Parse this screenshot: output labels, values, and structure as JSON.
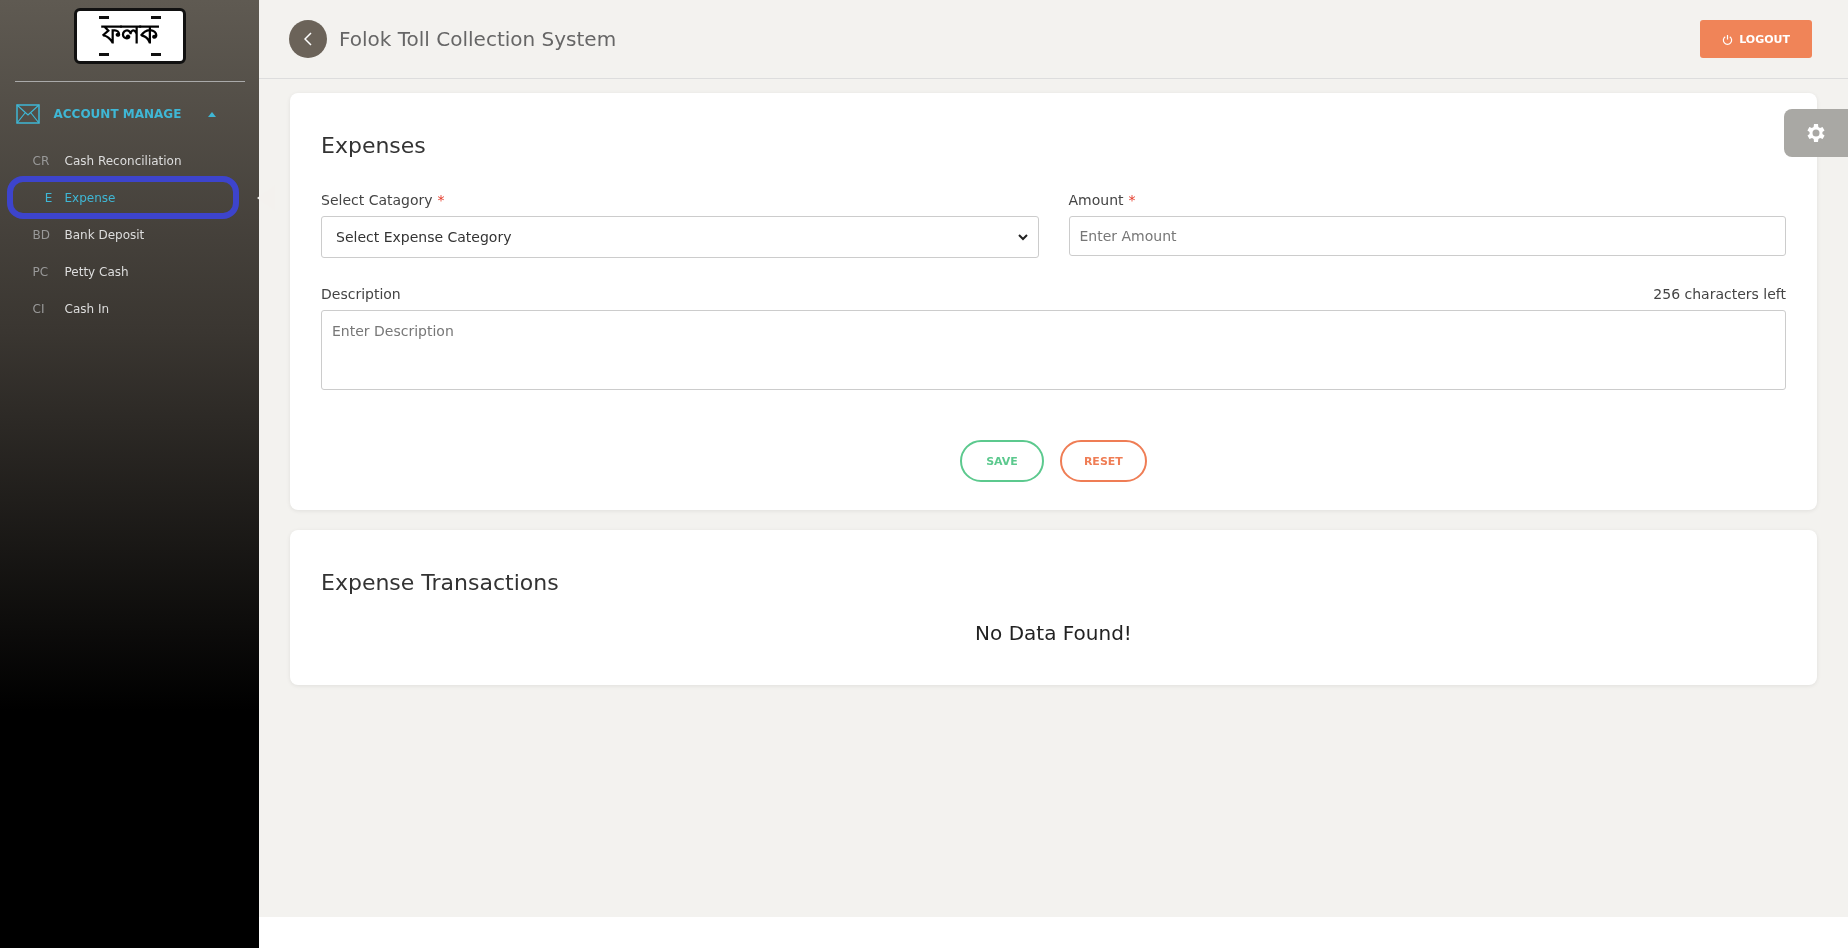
{
  "sidebar": {
    "logo_text": "ফলক",
    "section": {
      "label": "ACCOUNT MANAGE",
      "expanded": true
    },
    "items": [
      {
        "abbr": "CR",
        "label": "Cash Reconciliation",
        "selected": false,
        "circled": false
      },
      {
        "abbr": "E",
        "label": "Expense",
        "selected": true,
        "circled": true
      },
      {
        "abbr": "BD",
        "label": "Bank Deposit",
        "selected": false,
        "circled": false
      },
      {
        "abbr": "PC",
        "label": "Petty Cash",
        "selected": false,
        "circled": false
      },
      {
        "abbr": "CI",
        "label": "Cash In",
        "selected": false,
        "circled": false
      }
    ]
  },
  "header": {
    "title": "Folok Toll Collection System",
    "logout": "LOGOUT"
  },
  "form": {
    "title": "Expenses",
    "category": {
      "label": "Select Catagory",
      "required_mark": "*",
      "value": "Select Expense Category"
    },
    "amount": {
      "label": "Amount",
      "required_mark": "*",
      "placeholder": "Enter Amount"
    },
    "description": {
      "label": "Description",
      "counter": "256 characters left",
      "placeholder": "Enter Description"
    },
    "buttons": [
      {
        "kind": "save",
        "label": "SAVE"
      },
      {
        "kind": "reset",
        "label": "RESET"
      }
    ]
  },
  "transactions": {
    "title": "Expense Transactions",
    "empty": "No Data Found!"
  }
}
